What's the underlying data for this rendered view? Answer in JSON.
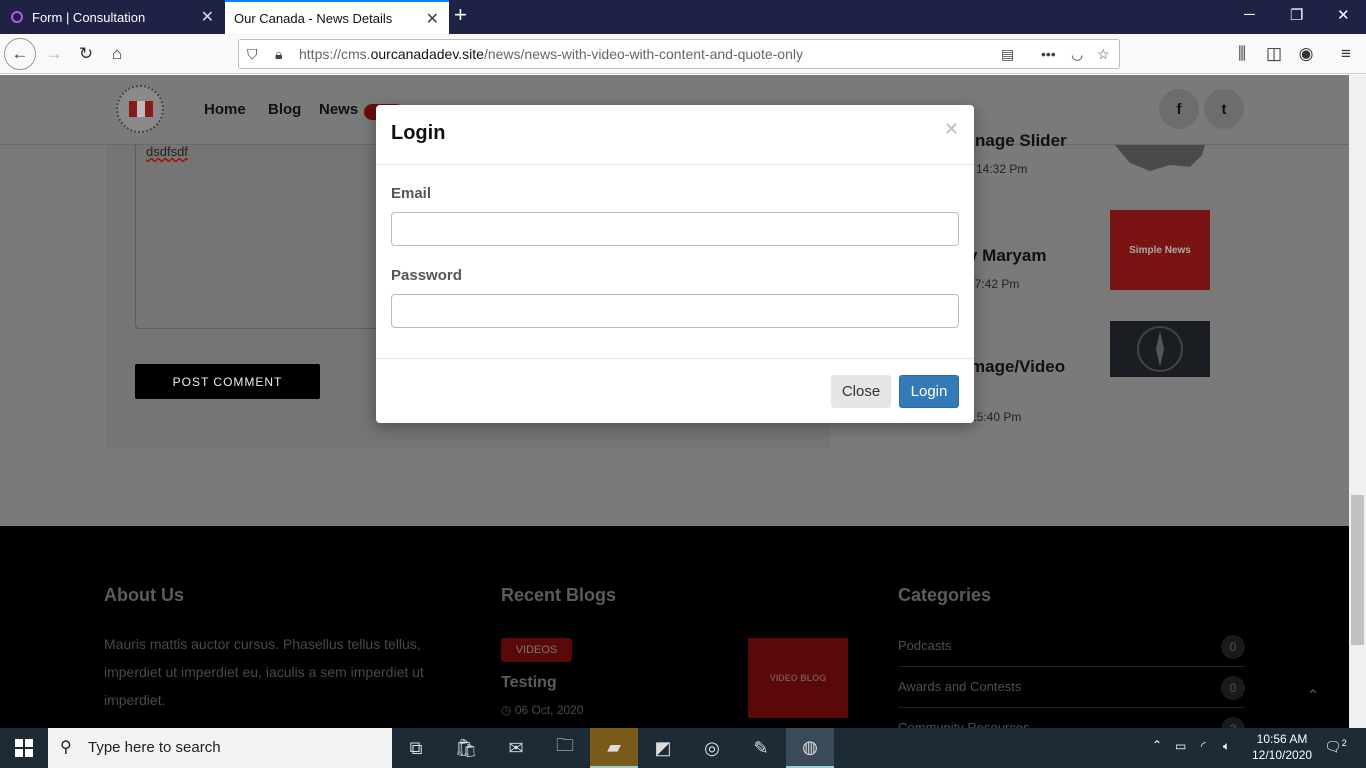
{
  "browser": {
    "tabs": [
      {
        "label": "Form | Consultation"
      },
      {
        "label": "Our Canada - News Details"
      }
    ],
    "url_prefix": "https://cms.",
    "url_host": "ourcanadadev.site",
    "url_path": "/news/news-with-video-with-content-and-quote-only"
  },
  "header": {
    "nav": [
      {
        "label": "Home"
      },
      {
        "label": "Blog"
      },
      {
        "label": "News"
      }
    ],
    "social": [
      "f",
      "t"
    ]
  },
  "comment": {
    "textarea_value": "dsdfsdf",
    "post_label": "POST COMMENT"
  },
  "sidebar": {
    "items": [
      {
        "title_fragment": "nage Slider",
        "time_fragment": "14:32 Pm"
      },
      {
        "title_fragment": "y Maryam",
        "time_fragment": "17:42 Pm",
        "thumb": "Simple News"
      },
      {
        "title_fragment": "mage/Video",
        "time_fragment": "15:40 Pm"
      }
    ]
  },
  "modal": {
    "title": "Login",
    "email_label": "Email",
    "password_label": "Password",
    "email_value": "",
    "password_value": "",
    "close_label": "Close",
    "login_label": "Login"
  },
  "footer": {
    "about_heading": "About Us",
    "about_text": "Mauris mattis auctor cursus. Phasellus tellus tellus, imperdiet ut imperdiet eu, iaculis a sem imperdiet ut imperdiet.",
    "blogs_heading": "Recent Blogs",
    "blog_badge": "VIDEOS",
    "blog_title": "Testing",
    "blog_date": "06 Oct, 2020",
    "blog_thumb": "VIDEO BLOG",
    "categories_heading": "Categories",
    "categories": [
      {
        "label": "Podcasts",
        "count": "0"
      },
      {
        "label": "Awards and Contests",
        "count": "0"
      },
      {
        "label": "Community Resources",
        "count": "3"
      }
    ]
  },
  "taskbar": {
    "search_placeholder": "Type here to search",
    "time": "10:56 AM",
    "date": "12/10/2020",
    "notifications": "2"
  }
}
